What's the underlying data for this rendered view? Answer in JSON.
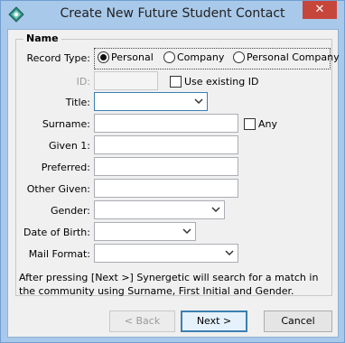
{
  "window": {
    "title": "Create New Future Student Contact",
    "close_glyph": "✕",
    "icon": "synergetic-app-icon"
  },
  "group": {
    "title": "Name"
  },
  "record_type": {
    "label": "Record Type:",
    "options": [
      "Personal",
      "Company",
      "Personal Company"
    ],
    "selected": "Personal"
  },
  "id_field": {
    "label": "ID:",
    "value": "",
    "use_existing_label": "Use existing ID",
    "use_existing_checked": false
  },
  "fields": {
    "title_label": "Title:",
    "title_value": "",
    "surname_label": "Surname:",
    "surname_value": "",
    "any_label": "Any",
    "any_checked": false,
    "given1_label": "Given 1:",
    "given1_value": "",
    "preferred_label": "Preferred:",
    "preferred_value": "",
    "other_given_label": "Other Given:",
    "other_given_value": "",
    "gender_label": "Gender:",
    "gender_value": "",
    "dob_label": "Date of Birth:",
    "dob_value": "",
    "mail_format_label": "Mail Format:",
    "mail_format_value": ""
  },
  "note": "After pressing [Next >] Synergetic will search for a match in the community using Surname, First Initial and Gender.",
  "buttons": {
    "back": "< Back",
    "next": "Next >",
    "cancel": "Cancel"
  }
}
